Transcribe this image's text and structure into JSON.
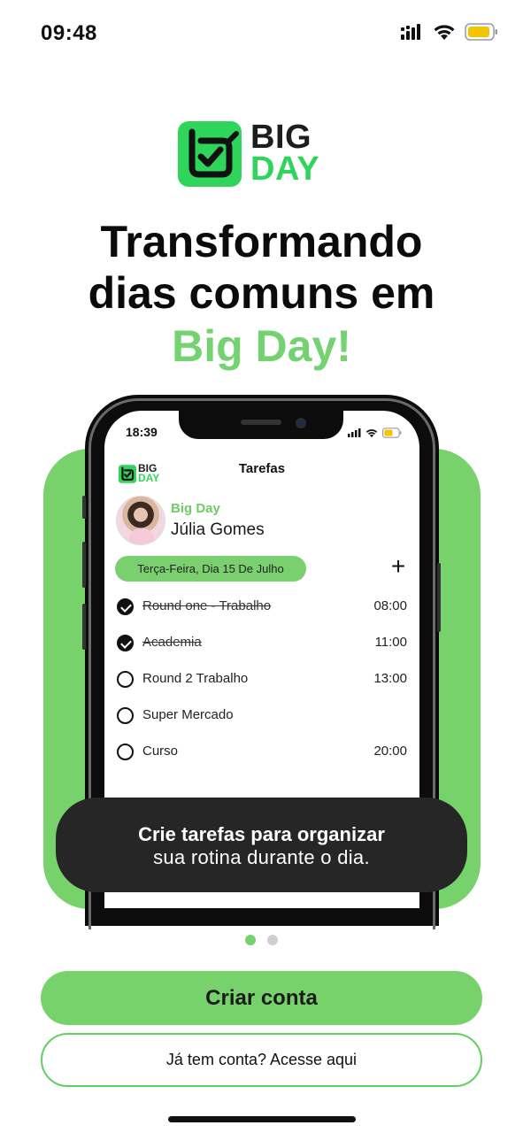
{
  "status_bar": {
    "time": "09:48"
  },
  "logo": {
    "line1": "BIG",
    "line2": "DAY"
  },
  "headline": {
    "line1": "Transformando",
    "line2": "dias comuns em",
    "accent": "Big Day!"
  },
  "phone_preview": {
    "status_time": "18:39",
    "logo_line1": "BIG",
    "logo_line2": "DAY",
    "title": "Tarefas",
    "app_name": "Big Day",
    "user_name": "Júlia Gomes",
    "date_label": "Terça-Feira, Dia 15 De Julho",
    "add_symbol": "+",
    "tasks": [
      {
        "name": "Round one - Trabalho",
        "time": "08:00",
        "done": true
      },
      {
        "name": "Academia",
        "time": "11:00",
        "done": true
      },
      {
        "name": "Round 2 Trabalho",
        "time": "13:00",
        "done": false
      },
      {
        "name": "Super Mercado",
        "time": "",
        "done": false
      },
      {
        "name": "Curso",
        "time": "20:00",
        "done": false
      }
    ]
  },
  "caption": {
    "line1": "Crie tarefas para organizar",
    "line2": "sua rotina durante o dia."
  },
  "pagination": {
    "current": 1,
    "total": 2
  },
  "buttons": {
    "primary": "Criar conta",
    "secondary": "Já tem conta? Acesse aqui"
  },
  "colors": {
    "brand_green": "#2fd55b",
    "accent_green": "#77d26b",
    "dark": "#262626"
  }
}
